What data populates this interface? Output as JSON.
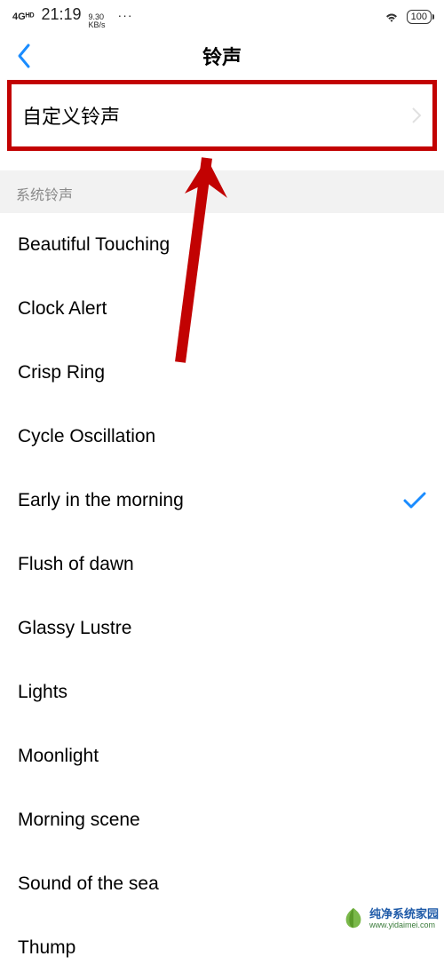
{
  "status": {
    "signal": "4Gᴴᴰ",
    "time": "21:19",
    "speed_value": "9.30",
    "speed_unit": "KB/s",
    "dots": "···",
    "battery": "100"
  },
  "nav": {
    "title": "铃声"
  },
  "custom": {
    "label": "自定义铃声"
  },
  "section": {
    "header": "系统铃声"
  },
  "ringtones": [
    {
      "name": "Beautiful Touching",
      "selected": false
    },
    {
      "name": "Clock Alert",
      "selected": false
    },
    {
      "name": "Crisp Ring",
      "selected": false
    },
    {
      "name": "Cycle Oscillation",
      "selected": false
    },
    {
      "name": "Early in the morning",
      "selected": true
    },
    {
      "name": "Flush of dawn",
      "selected": false
    },
    {
      "name": "Glassy Lustre",
      "selected": false
    },
    {
      "name": "Lights",
      "selected": false
    },
    {
      "name": "Moonlight",
      "selected": false
    },
    {
      "name": "Morning scene",
      "selected": false
    },
    {
      "name": "Sound of the sea",
      "selected": false
    },
    {
      "name": "Thump",
      "selected": false
    }
  ],
  "watermark": {
    "brand": "纯净系统家园",
    "url": "www.yidaimei.com"
  },
  "annotation": {
    "highlight_color": "#c20202",
    "arrow_color": "#c20202"
  }
}
